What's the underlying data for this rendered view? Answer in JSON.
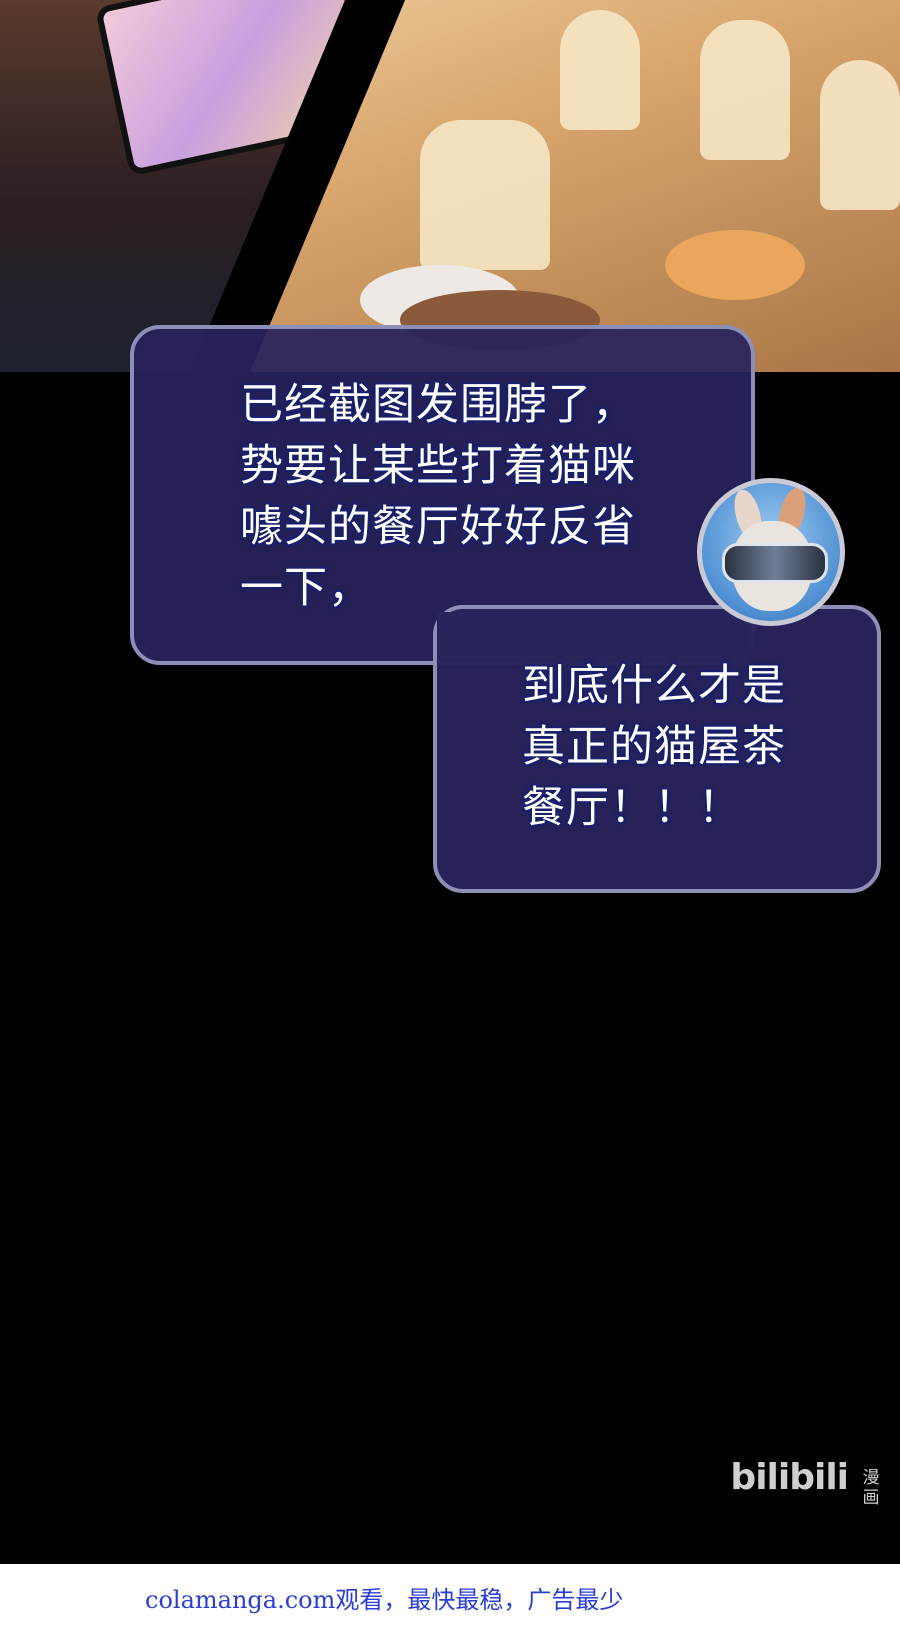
{
  "bubble_1": {
    "lines": [
      "已经截图发围脖了，",
      "势要让某些打着猫咪",
      "噱头的餐厅好好反省",
      "一下，"
    ]
  },
  "bubble_2": {
    "lines": [
      "到底什么才是",
      "真正的猫屋茶",
      "餐厅！！！"
    ]
  },
  "watermark": {
    "logo": "bilibili",
    "logo_sub": "漫画"
  },
  "footer": {
    "text": "colamanga.com观看，最快最稳，广告最少"
  },
  "colors": {
    "bubble_fill": "#28245c",
    "bubble_border": "#8d8fb8",
    "footer_link": "#2a3ed6"
  }
}
